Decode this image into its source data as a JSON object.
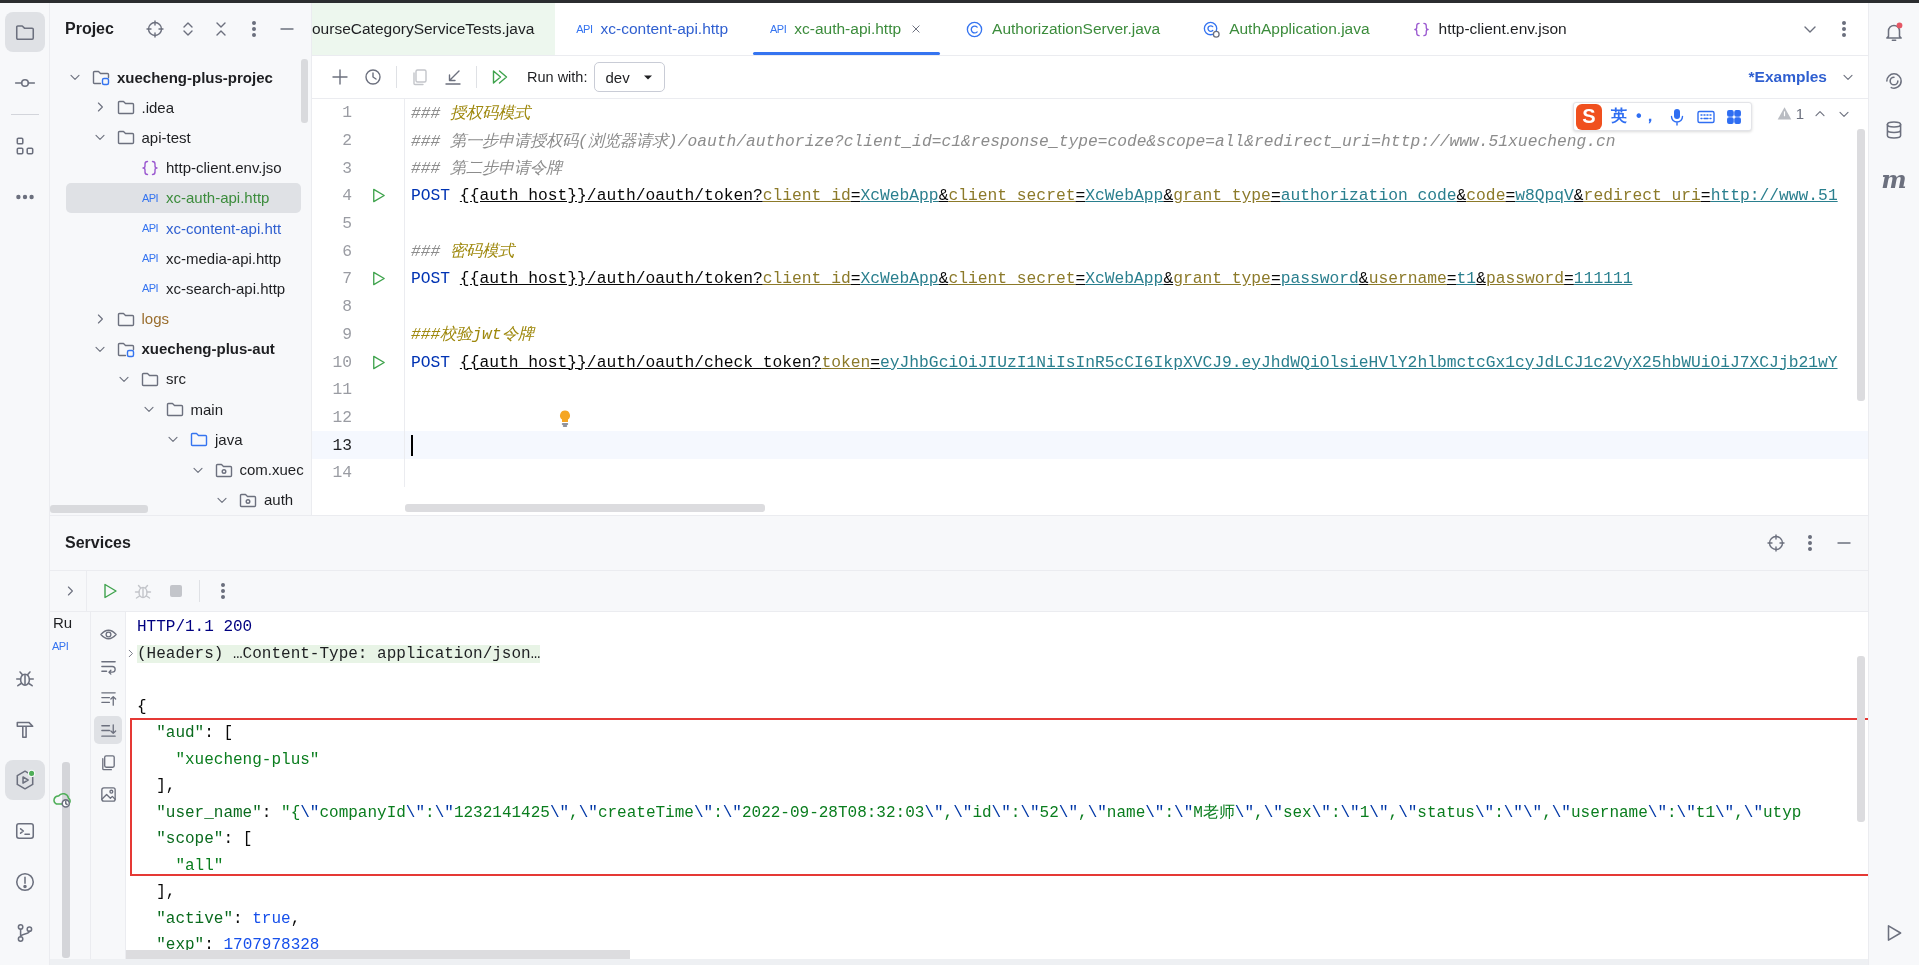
{
  "activity_bar": {
    "top": [
      {
        "kind": "project",
        "selected": true
      },
      {
        "kind": "commit",
        "selected": false
      },
      {
        "kind": "structure",
        "selected": false
      },
      {
        "kind": "more",
        "selected": false
      }
    ],
    "bottom": [
      {
        "kind": "debug",
        "selected": false
      },
      {
        "kind": "build",
        "selected": false
      },
      {
        "kind": "services",
        "selected": true
      },
      {
        "kind": "terminal",
        "selected": false
      },
      {
        "kind": "problems",
        "selected": false
      },
      {
        "kind": "git",
        "selected": false
      }
    ]
  },
  "project_panel": {
    "title": "Projec",
    "tree": [
      {
        "label": "xuecheng-plus-projec",
        "kind": "module",
        "expanded": true,
        "selected": false,
        "color": "#1e1f22",
        "children": [
          {
            "label": ".idea",
            "kind": "folder",
            "expanded": false,
            "selected": false,
            "color": "#1e1f22"
          },
          {
            "label": "api-test",
            "kind": "folder",
            "expanded": true,
            "selected": false,
            "color": "#1e1f22",
            "children": [
              {
                "label": "http-client.env.jso",
                "kind": "json",
                "selected": false,
                "color": "#1e1f22"
              },
              {
                "label": "xc-auth-api.http",
                "kind": "http",
                "badge": "API",
                "selected": true,
                "color": "#3c8c3c"
              },
              {
                "label": "xc-content-api.htt",
                "kind": "http",
                "badge": "API",
                "selected": false,
                "color": "#2f5fd0"
              },
              {
                "label": "xc-media-api.http",
                "kind": "http",
                "badge": "API",
                "selected": false,
                "color": "#1e1f22"
              },
              {
                "label": "xc-search-api.http",
                "kind": "http",
                "badge": "API",
                "selected": false,
                "color": "#1e1f22"
              }
            ]
          },
          {
            "label": "logs",
            "kind": "folder",
            "expanded": false,
            "selected": false,
            "color": "#9a6e2e"
          },
          {
            "label": "xuecheng-plus-aut",
            "kind": "module",
            "expanded": true,
            "selected": false,
            "color": "#1e1f22",
            "children": [
              {
                "label": "src",
                "kind": "folder",
                "expanded": true,
                "selected": false,
                "color": "#1e1f22",
                "children": [
                  {
                    "label": "main",
                    "kind": "folder",
                    "expanded": true,
                    "selected": false,
                    "color": "#1e1f22",
                    "children": [
                      {
                        "label": "java",
                        "kind": "source",
                        "expanded": true,
                        "selected": false,
                        "color": "#1e1f22",
                        "children": [
                          {
                            "label": "com.xuec",
                            "kind": "package",
                            "expanded": true,
                            "selected": false,
                            "color": "#1e1f22",
                            "children": [
                              {
                                "label": "auth",
                                "kind": "package",
                                "expanded": true,
                                "selected": false,
                                "color": "#1e1f22"
                              }
                            ]
                          }
                        ]
                      }
                    ]
                  }
                ]
              }
            ]
          }
        ]
      }
    ]
  },
  "editor": {
    "tabs": [
      {
        "label": "ourseCategoryServiceTests.java",
        "kind": "plain",
        "test": true,
        "selected": false,
        "color": "#1e1f22"
      },
      {
        "label": "xc-content-api.http",
        "kind": "api",
        "badge": "API",
        "test": false,
        "selected": false,
        "color": "#2f5fd0"
      },
      {
        "label": "xc-auth-api.http",
        "kind": "api",
        "badge": "API",
        "test": false,
        "selected": true,
        "color": "#3c8c3c"
      },
      {
        "label": "AuthorizationServer.java",
        "kind": "class",
        "test": false,
        "selected": false,
        "color": "#3c8c3c"
      },
      {
        "label": "AuthApplication.java",
        "kind": "app",
        "test": false,
        "selected": false,
        "color": "#3c8c3c"
      },
      {
        "label": "http-client.env.json",
        "kind": "json",
        "test": false,
        "selected": false,
        "color": "#1e1f22"
      }
    ],
    "actions": [
      {
        "kind": "add",
        "enabled": true
      },
      {
        "kind": "history",
        "enabled": true
      },
      {
        "kind": "copy",
        "enabled": false
      },
      {
        "kind": "import",
        "enabled": true
      },
      {
        "kind": "run-all",
        "enabled": true
      }
    ],
    "run_with_label": "Run with:",
    "environment": "dev",
    "examples_link": "*Examples",
    "ime": {
      "logo": "S",
      "mode": "英",
      "punctuation": "•，"
    },
    "warnings": "1",
    "lines": [
      {
        "number": "1",
        "run": false,
        "bulb": false,
        "current": false,
        "segments": [
          {
            "text": "### ",
            "kind": "comment"
          },
          {
            "text": "授权码模式",
            "kind": "name"
          }
        ]
      },
      {
        "number": "2",
        "run": false,
        "bulb": false,
        "current": false,
        "segments": [
          {
            "text": "### 第一步申请授权码(浏览器请求)/oauth/authorize?client_id=c1&response_type=code&scope=all&redirect_uri=http://www.51xuecheng.cn",
            "kind": "comment"
          }
        ]
      },
      {
        "number": "3",
        "run": false,
        "bulb": false,
        "current": false,
        "segments": [
          {
            "text": "### 第二步申请令牌",
            "kind": "comment"
          }
        ]
      },
      {
        "number": "4",
        "run": true,
        "bulb": false,
        "current": false,
        "segments": [
          {
            "text": "POST ",
            "kind": "method"
          },
          {
            "text": "{{auth_host}}/auth/oauth/token?",
            "kind": "url"
          },
          {
            "text": "client_id",
            "kind": "param"
          },
          {
            "text": "=",
            "kind": "url"
          },
          {
            "text": "XcWebApp",
            "kind": "value"
          },
          {
            "text": "&",
            "kind": "url"
          },
          {
            "text": "client_secret",
            "kind": "param"
          },
          {
            "text": "=",
            "kind": "url"
          },
          {
            "text": "XcWebApp",
            "kind": "value"
          },
          {
            "text": "&",
            "kind": "url"
          },
          {
            "text": "grant_type",
            "kind": "param"
          },
          {
            "text": "=",
            "kind": "url"
          },
          {
            "text": "authorization_code",
            "kind": "value"
          },
          {
            "text": "&",
            "kind": "url"
          },
          {
            "text": "code",
            "kind": "param"
          },
          {
            "text": "=",
            "kind": "url"
          },
          {
            "text": "w8QpqV",
            "kind": "value"
          },
          {
            "text": "&",
            "kind": "url"
          },
          {
            "text": "redirect_uri",
            "kind": "param"
          },
          {
            "text": "=",
            "kind": "url"
          },
          {
            "text": "http://www.51",
            "kind": "value"
          }
        ]
      },
      {
        "number": "5",
        "run": false,
        "bulb": false,
        "current": false
      },
      {
        "number": "6",
        "run": false,
        "bulb": false,
        "current": false,
        "segments": [
          {
            "text": "### ",
            "kind": "comment"
          },
          {
            "text": "密码模式",
            "kind": "name"
          }
        ]
      },
      {
        "number": "7",
        "run": true,
        "bulb": false,
        "current": false,
        "segments": [
          {
            "text": "POST ",
            "kind": "method"
          },
          {
            "text": "{{auth_host}}/auth/oauth/token?",
            "kind": "url"
          },
          {
            "text": "client_id",
            "kind": "param"
          },
          {
            "text": "=",
            "kind": "url"
          },
          {
            "text": "XcWebApp",
            "kind": "value"
          },
          {
            "text": "&",
            "kind": "url"
          },
          {
            "text": "client_secret",
            "kind": "param"
          },
          {
            "text": "=",
            "kind": "url"
          },
          {
            "text": "XcWebApp",
            "kind": "value"
          },
          {
            "text": "&",
            "kind": "url"
          },
          {
            "text": "grant_type",
            "kind": "param"
          },
          {
            "text": "=",
            "kind": "url"
          },
          {
            "text": "password",
            "kind": "value"
          },
          {
            "text": "&",
            "kind": "url"
          },
          {
            "text": "username",
            "kind": "param"
          },
          {
            "text": "=",
            "kind": "url"
          },
          {
            "text": "t1",
            "kind": "value"
          },
          {
            "text": "&",
            "kind": "url"
          },
          {
            "text": "password",
            "kind": "param"
          },
          {
            "text": "=",
            "kind": "url"
          },
          {
            "text": "111111",
            "kind": "value"
          }
        ]
      },
      {
        "number": "8",
        "run": false,
        "bulb": false,
        "current": false
      },
      {
        "number": "9",
        "run": false,
        "bulb": false,
        "current": false,
        "segments": [
          {
            "text": "###校验jwt令牌",
            "kind": "name"
          }
        ]
      },
      {
        "number": "10",
        "run": true,
        "bulb": false,
        "current": false,
        "segments": [
          {
            "text": "POST ",
            "kind": "method"
          },
          {
            "text": "{{auth_host}}/auth/oauth/check_token?",
            "kind": "url"
          },
          {
            "text": "token",
            "kind": "param"
          },
          {
            "text": "=",
            "kind": "url"
          },
          {
            "text": "eyJhbGciOiJIUzI1NiIsInR5cCI6IkpXVCJ9.eyJhdWQiOlsieHVlY2hlbmctcGx1cyJdLCJ1c2VyX25hbWUiOiJ7XCJjb21wY",
            "kind": "value"
          }
        ]
      },
      {
        "number": "11",
        "run": false,
        "bulb": false,
        "current": false
      },
      {
        "number": "12",
        "run": false,
        "bulb": true,
        "current": false
      },
      {
        "number": "13",
        "run": false,
        "bulb": false,
        "current": true
      },
      {
        "number": "14",
        "run": false,
        "bulb": false,
        "current": false
      }
    ]
  },
  "services": {
    "title": "Services",
    "toolbar": [
      {
        "kind": "run",
        "enabled": true
      },
      {
        "kind": "debug",
        "enabled": false
      },
      {
        "kind": "stop",
        "enabled": false
      }
    ],
    "tree_label": "Ru",
    "tree_badge": "API",
    "tools": [
      {
        "kind": "eye",
        "selected": false
      },
      {
        "kind": "wrap",
        "selected": false
      },
      {
        "kind": "scroll-top",
        "selected": false
      },
      {
        "kind": "scroll-end",
        "selected": true
      },
      {
        "kind": "copy",
        "selected": false
      },
      {
        "kind": "image",
        "selected": false
      }
    ],
    "output": [
      {
        "kind": "status",
        "segments": [
          {
            "text": "HTTP/1.1 200",
            "kind": "status"
          }
        ]
      },
      {
        "kind": "folded",
        "segments": [
          {
            "text": "(Headers) …Content-Type: application/json…",
            "kind": "folded"
          }
        ]
      },
      {
        "kind": "blank"
      },
      {
        "kind": "json",
        "segments": [
          {
            "text": "{",
            "kind": "punct"
          }
        ]
      },
      {
        "kind": "json",
        "segments": [
          {
            "text": "  \"aud\"",
            "kind": "key"
          },
          {
            "text": ": [",
            "kind": "punct"
          }
        ]
      },
      {
        "kind": "json",
        "segments": [
          {
            "text": "    \"xuecheng-plus\"",
            "kind": "string"
          }
        ]
      },
      {
        "kind": "json",
        "segments": [
          {
            "text": "  ],",
            "kind": "punct"
          }
        ]
      },
      {
        "kind": "json",
        "segments": [
          {
            "text": "  \"user_name\"",
            "kind": "key"
          },
          {
            "text": ": ",
            "kind": "punct"
          },
          {
            "text": "\"{\\\"companyId\\\":\\\"1232141425\\\",\\\"createTime\\\":\\\"2022-09-28T08:32:03\\\",\\\"id\\\":\\\"52\\\",\\\"name\\\":\\\"M老师\\\",\\\"sex\\\":\\\"1\\\",\\\"status\\\":\\\"\\\",\\\"username\\\":\\\"t1\\\",\\\"utyp",
            "kind": "string"
          }
        ]
      },
      {
        "kind": "json",
        "segments": [
          {
            "text": "  \"scope\"",
            "kind": "key"
          },
          {
            "text": ": [",
            "kind": "punct"
          }
        ]
      },
      {
        "kind": "json",
        "segments": [
          {
            "text": "    \"all\"",
            "kind": "string"
          }
        ]
      },
      {
        "kind": "json",
        "segments": [
          {
            "text": "  ],",
            "kind": "punct"
          }
        ]
      },
      {
        "kind": "json",
        "segments": [
          {
            "text": "  \"active\"",
            "kind": "key"
          },
          {
            "text": ": ",
            "kind": "punct"
          },
          {
            "text": "true",
            "kind": "keyword"
          },
          {
            "text": ",",
            "kind": "punct"
          }
        ]
      },
      {
        "kind": "json",
        "segments": [
          {
            "text": "  \"exp\"",
            "kind": "key"
          },
          {
            "text": ": ",
            "kind": "punct"
          },
          {
            "text": "1707978328",
            "kind": "number"
          }
        ]
      }
    ],
    "annotations": [
      {
        "kind": "frame"
      }
    ]
  },
  "right_bar": {
    "top": [
      {
        "kind": "bell",
        "selected": false
      },
      {
        "kind": "spiral",
        "selected": false
      },
      {
        "kind": "database",
        "selected": false
      },
      {
        "kind": "letter",
        "text": "m",
        "selected": false
      }
    ],
    "bottom": [
      {
        "kind": "play",
        "selected": false
      }
    ]
  }
}
